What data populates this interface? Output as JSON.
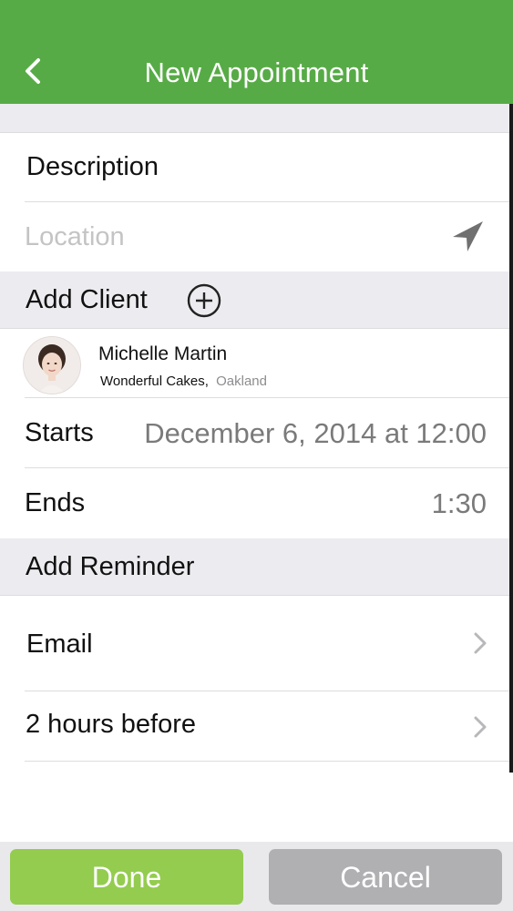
{
  "header": {
    "title": "New Appointment",
    "back_icon": "chevron-left-icon",
    "color": "#57ab46"
  },
  "form": {
    "description": {
      "value": "Description"
    },
    "location": {
      "placeholder": "Location",
      "icon": "location-arrow-icon"
    }
  },
  "client": {
    "section_label": "Add Client",
    "add_icon": "plus-circle-icon",
    "name": "Michelle Martin",
    "company": "Wonderful Cakes,",
    "city": "Oakland"
  },
  "schedule": {
    "starts_label": "Starts",
    "starts_value": "December 6, 2014 at 12:00",
    "ends_label": "Ends",
    "ends_value": "1:30"
  },
  "reminder": {
    "section_label": "Add Reminder",
    "items": [
      {
        "label": "Email"
      },
      {
        "label": "2 hours before"
      }
    ]
  },
  "footer": {
    "done_label": "Done",
    "cancel_label": "Cancel",
    "done_color": "#94cc4f",
    "cancel_color": "#b0b0b3"
  }
}
